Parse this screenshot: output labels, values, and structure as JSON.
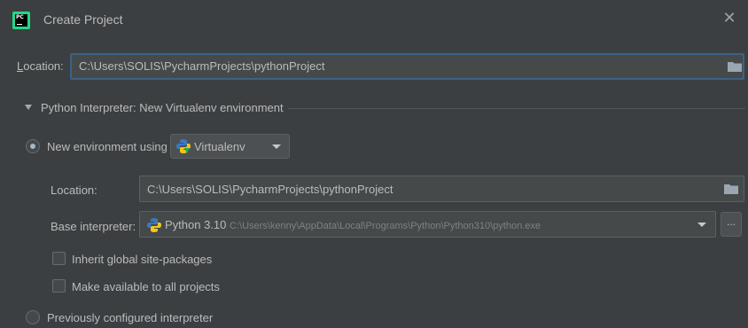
{
  "window": {
    "title": "Create Project",
    "app_icon_text": "PC"
  },
  "location": {
    "label_prefix": "L",
    "label_rest": "ocation:",
    "value": "C:\\Users\\SOLIS\\PycharmProjects\\pythonProject"
  },
  "interpreter_section": {
    "title": "Python Interpreter: New Virtualenv environment",
    "expanded": true
  },
  "new_env": {
    "label": "New environment using",
    "selected": true,
    "tool": "Virtualenv",
    "env_location_label": "Location:",
    "env_location_value": "C:\\Users\\SOLIS\\PycharmProjects\\pythonProject",
    "base_interpreter_label": "Base interpreter:",
    "base_interpreter_name": "Python 3.10",
    "base_interpreter_path": "C:\\Users\\kenny\\AppData\\Local\\Programs\\Python\\Python310\\python.exe",
    "browse_label": "...",
    "inherit_label": "Inherit global site-packages",
    "inherit_checked": false,
    "available_label": "Make available to all projects",
    "available_checked": false
  },
  "previous": {
    "label": "Previously configured interpreter",
    "selected": false
  },
  "icons": [
    "pycharm-app-icon",
    "close-icon",
    "folder-icon",
    "python-icon",
    "chevron-down-icon"
  ],
  "colors": {
    "background": "#3c3f41",
    "field": "#45494a",
    "focus_border": "#3d6185",
    "text": "#bbbbbb"
  }
}
